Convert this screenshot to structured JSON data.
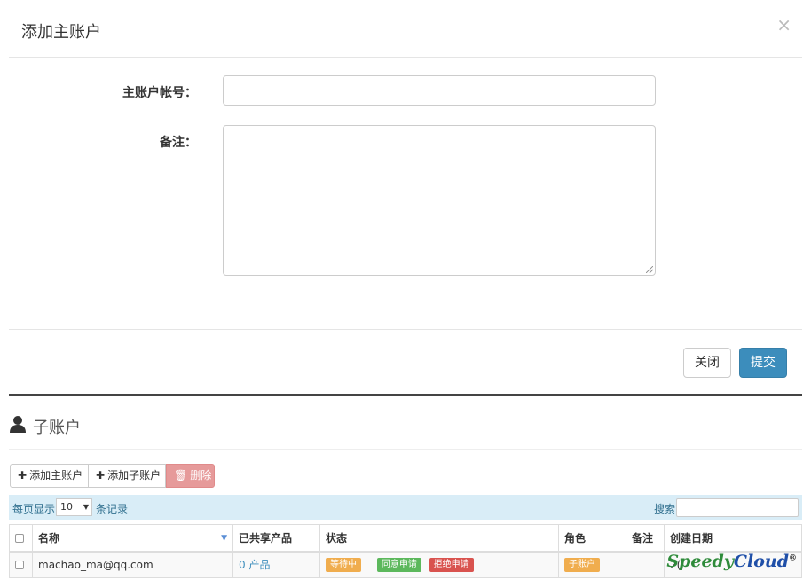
{
  "modal": {
    "title": "添加主账户",
    "close_symbol": "×",
    "fields": {
      "account_label": "主账户帐号：",
      "account_value": "",
      "remark_label": "备注：",
      "remark_value": ""
    },
    "buttons": {
      "close": "关闭",
      "submit": "提交"
    }
  },
  "section": {
    "title": "子账户",
    "icon": "user-icon"
  },
  "toolbar": {
    "add_main": "添加主账户",
    "add_sub": "添加子账户",
    "delete": "删除"
  },
  "filter": {
    "per_page_label": "每页显示",
    "per_page_value": "10",
    "records_label": "条记录",
    "search_label": "搜索",
    "search_value": ""
  },
  "table": {
    "headers": [
      "名称",
      "已共享产品",
      "状态",
      "角色",
      "备注",
      "创建日期"
    ],
    "rows": [
      {
        "name": "machao_ma@qq.com",
        "shared": "0 产品",
        "status_badges": [
          "等待中",
          "同意申请",
          "拒绝申请"
        ],
        "role": "子账户",
        "remark": "",
        "created": "2("
      }
    ]
  },
  "watermark": {
    "speedy": "Speedy",
    "cloud": "Cloud",
    "mark": "®"
  },
  "colors": {
    "primary": "#3c8dbc",
    "danger_light": "#e69a9a",
    "info_bg": "#d9edf7",
    "warning": "#f0ad4e",
    "success": "#5cb85c",
    "danger": "#d9534f"
  }
}
